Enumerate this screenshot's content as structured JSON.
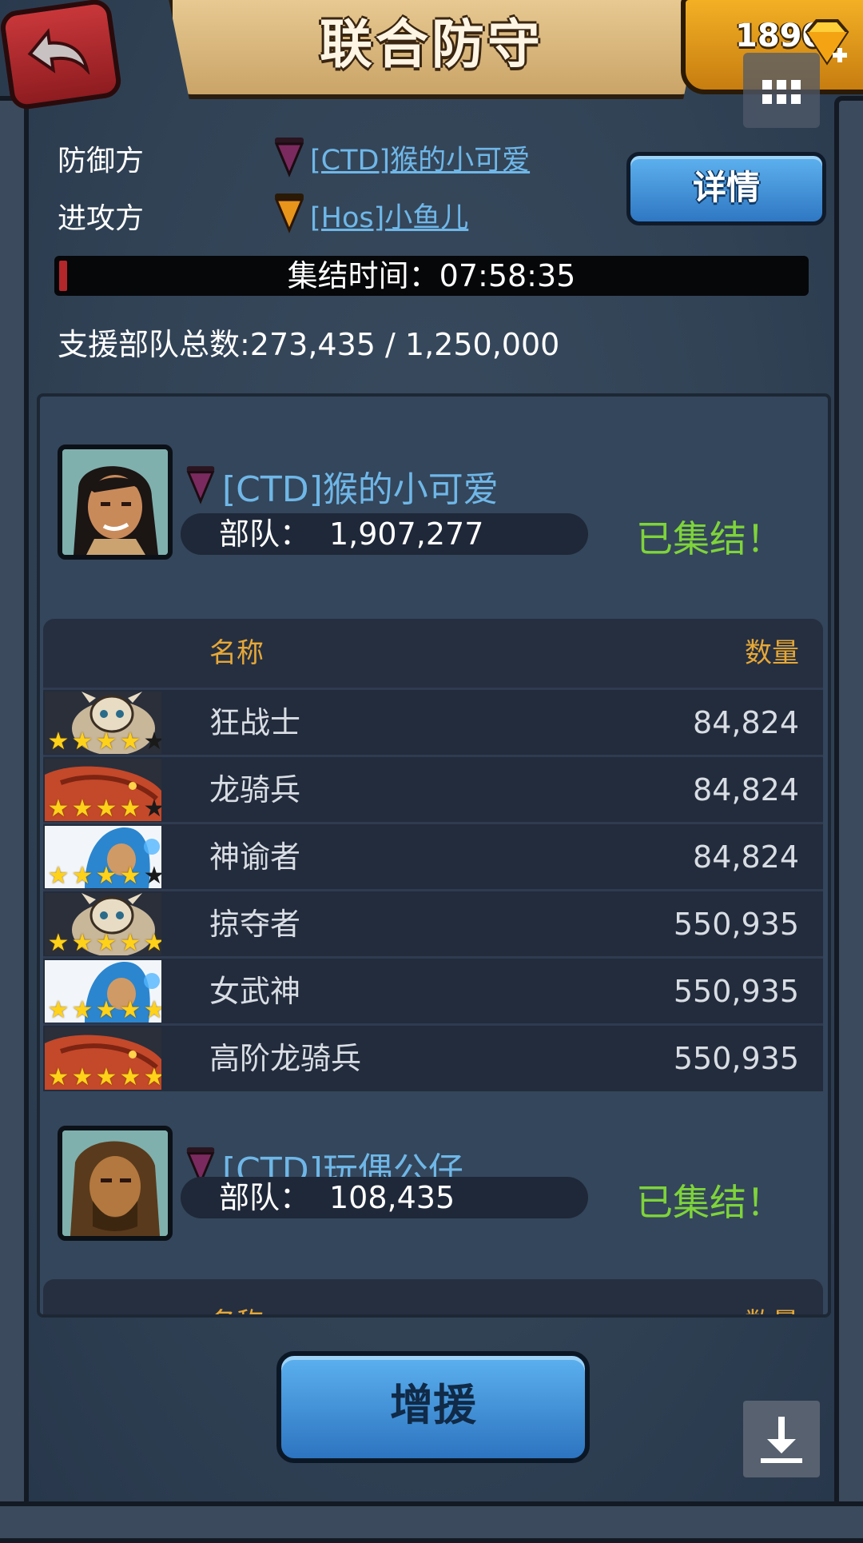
{
  "header": {
    "title": "联合防守",
    "gems": "1890",
    "back_icon": "back-arrow-icon",
    "menu_icon": "grid-menu-icon"
  },
  "sides": {
    "defender_label": "防御方",
    "defender_name": "[CTD]猴的小可爱",
    "defender_flag_color": "#7a2a5e",
    "attacker_label": "进攻方",
    "attacker_name": "[Hos]小鱼儿",
    "attacker_flag_color": "#e8951c",
    "detail_label": "详情"
  },
  "timer": {
    "text": "集结时间：07:58:35",
    "color": "#b3262a"
  },
  "total": {
    "text": "支援部队总数:273,435 / 1,250,000"
  },
  "cards": [
    {
      "name": "[CTD]猴的小可爱",
      "troops_label": "部队：",
      "troops_value": "1,907,277",
      "status": "已集结！",
      "table": {
        "col_name": "名称",
        "col_qty": "数量",
        "rows": [
          {
            "name": "狂战士",
            "qty": "84,824",
            "stars": 4,
            "icon": "skull-warrior-icon"
          },
          {
            "name": "龙骑兵",
            "qty": "84,824",
            "stars": 4,
            "icon": "red-dragon-icon"
          },
          {
            "name": "神谕者",
            "qty": "84,824",
            "stars": 4,
            "icon": "blue-hooded-mage-icon"
          },
          {
            "name": "掠夺者",
            "qty": "550,935",
            "stars": 5,
            "icon": "skull-warrior-icon"
          },
          {
            "name": "女武神",
            "qty": "550,935",
            "stars": 5,
            "icon": "blue-hooded-mage-icon"
          },
          {
            "name": "高阶龙骑兵",
            "qty": "550,935",
            "stars": 5,
            "icon": "red-dragon-icon"
          }
        ]
      }
    },
    {
      "name": "[CTD]玩偶公仔",
      "troops_label": "部队：",
      "troops_value": "108,435",
      "status": "已集结！",
      "table": {
        "col_name": "名称",
        "col_qty": "数量",
        "rows": []
      }
    }
  ],
  "footer": {
    "reinforce_label": "增援",
    "download_icon": "download-icon"
  }
}
